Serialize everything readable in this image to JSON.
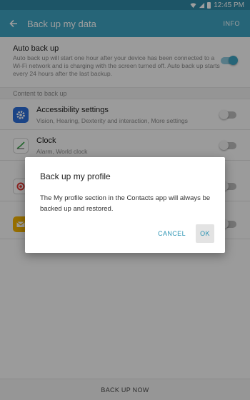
{
  "status_bar": {
    "time": "12:45 PM"
  },
  "app_bar": {
    "title": "Back up my data",
    "info": "INFO"
  },
  "auto_backup": {
    "title": "Auto back up",
    "description": "Auto back up will start one hour after your device has been connected to a Wi-Fi network and is charging with the screen turned off. Auto back up starts every 24 hours after the last backup.",
    "enabled": true
  },
  "section_header": "Content to back up",
  "items": [
    {
      "title": "Accessibility settings",
      "subtitle": "Vision, Hearing, Dexterity and interaction, More settings",
      "icon": "gear-icon",
      "enabled": false
    },
    {
      "title": "Clock",
      "subtitle": "Alarm, World clock",
      "icon": "clock-icon",
      "enabled": false
    },
    {
      "title": "",
      "subtitle": "",
      "icon": "target-icon",
      "enabled": false
    },
    {
      "title": "",
      "subtitle": "",
      "icon": "mail-icon",
      "enabled": false
    }
  ],
  "bottom_button": "BACK UP NOW",
  "dialog": {
    "title": "Back up my profile",
    "message": "The My profile section in the Contacts app will always be backed up and restored.",
    "cancel": "CANCEL",
    "ok": "OK"
  },
  "colors": {
    "accent": "#3ea4c2",
    "status_bar": "#2f8aa6",
    "dialog_button": "#2a93b3"
  }
}
